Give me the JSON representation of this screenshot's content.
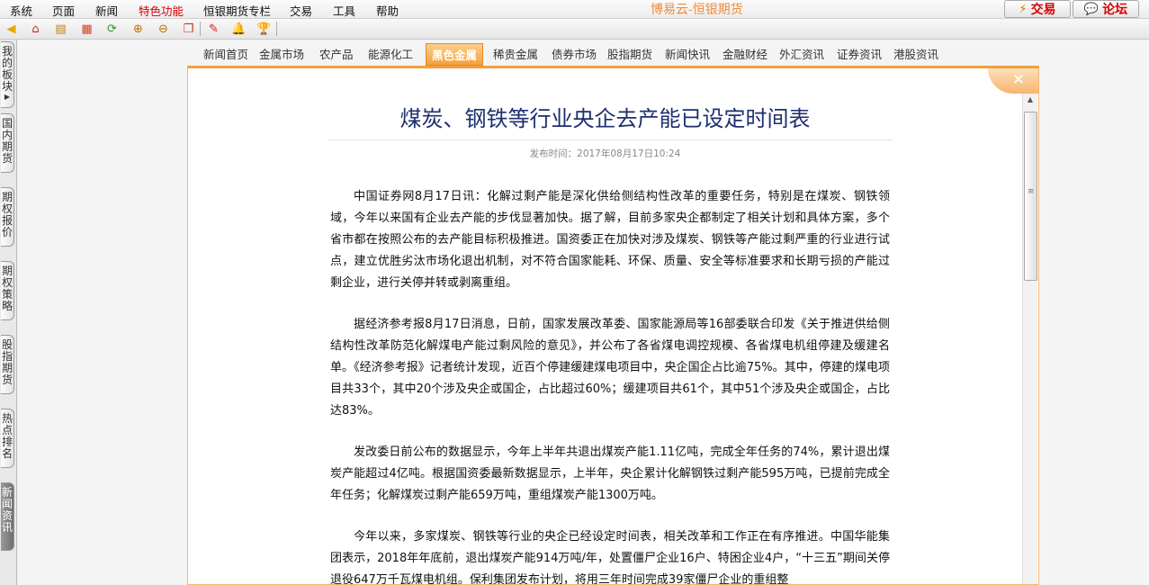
{
  "menu": [
    "系统",
    "页面",
    "新闻",
    "特色功能",
    "恒银期货专栏",
    "交易",
    "工具",
    "帮助"
  ],
  "menu_highlight_index": 3,
  "brand": "博易云-恒银期货",
  "top_buttons": {
    "trade": "交易",
    "forum": "论坛"
  },
  "toolbar_icons": [
    "back-icon",
    "home-icon",
    "book-icon",
    "grid-icon",
    "refresh-icon",
    "zoom-in-icon",
    "zoom-out-icon",
    "window-icon",
    "pencil-icon",
    "bell-icon",
    "cup-icon"
  ],
  "left_tabs": [
    {
      "label": "我的板块",
      "active": false
    },
    {
      "label": "国内期货",
      "active": false
    },
    {
      "label": "期权报价",
      "active": false
    },
    {
      "label": "期权策略",
      "active": false
    },
    {
      "label": "股指期货",
      "active": false
    },
    {
      "label": "热点排名",
      "active": false
    },
    {
      "label": "新闻资讯",
      "active": true
    }
  ],
  "nav": [
    "新闻首页",
    "金属市场",
    "农产品",
    "能源化工",
    "黑色金属",
    "稀贵金属",
    "债券市场",
    "股指期货",
    "新闻快讯",
    "金融财经",
    "外汇资讯",
    "证券资讯",
    "港股资讯"
  ],
  "nav_active_index": 4,
  "article": {
    "title": "煤炭、钢铁等行业央企去产能已设定时间表",
    "publish_time": "发布时间：2017年08月17日10:24",
    "paragraphs": [
      "中国证券网8月17日讯：化解过剩产能是深化供给侧结构性改革的重要任务，特别是在煤炭、钢铁领域，今年以来国有企业去产能的步伐显著加快。据了解，目前多家央企都制定了相关计划和具体方案，多个省市都在按照公布的去产能目标积极推进。国资委正在加快对涉及煤炭、钢铁等产能过剩严重的行业进行试点，建立优胜劣汰市场化退出机制，对不符合国家能耗、环保、质量、安全等标准要求和长期亏损的产能过剩企业，进行关停并转或剥离重组。",
      "据经济参考报8月17日消息，日前，国家发展改革委、国家能源局等16部委联合印发《关于推进供给侧结构性改革防范化解煤电产能过剩风险的意见》，并公布了各省煤电调控规模、各省煤电机组停建及缓建名单。《经济参考报》记者统计发现，近百个停建缓建煤电项目中，央企国企占比逾75%。其中，停建的煤电项目共33个，其中20个涉及央企或国企，占比超过60%；缓建项目共61个，其中51个涉及央企或国企，占比达83%。",
      "发改委日前公布的数据显示，今年上半年共退出煤炭产能1.11亿吨，完成全年任务的74%，累计退出煤炭产能超过4亿吨。根据国资委最新数据显示，上半年，央企累计化解钢铁过剩产能595万吨，已提前完成全年任务；化解煤炭过剩产能659万吨，重组煤炭产能1300万吨。",
      "今年以来，多家煤炭、钢铁等行业的央企已经设定时间表，相关改革和工作正在有序推进。中国华能集团表示，2018年年底前，退出煤炭产能914万吨/年，处置僵尸企业16户、特困企业4户，“十三五”期间关停退役647万千瓦煤电机组。保利集团发布计划，将用三年时间完成39家僵尸企业的重组整"
    ]
  }
}
